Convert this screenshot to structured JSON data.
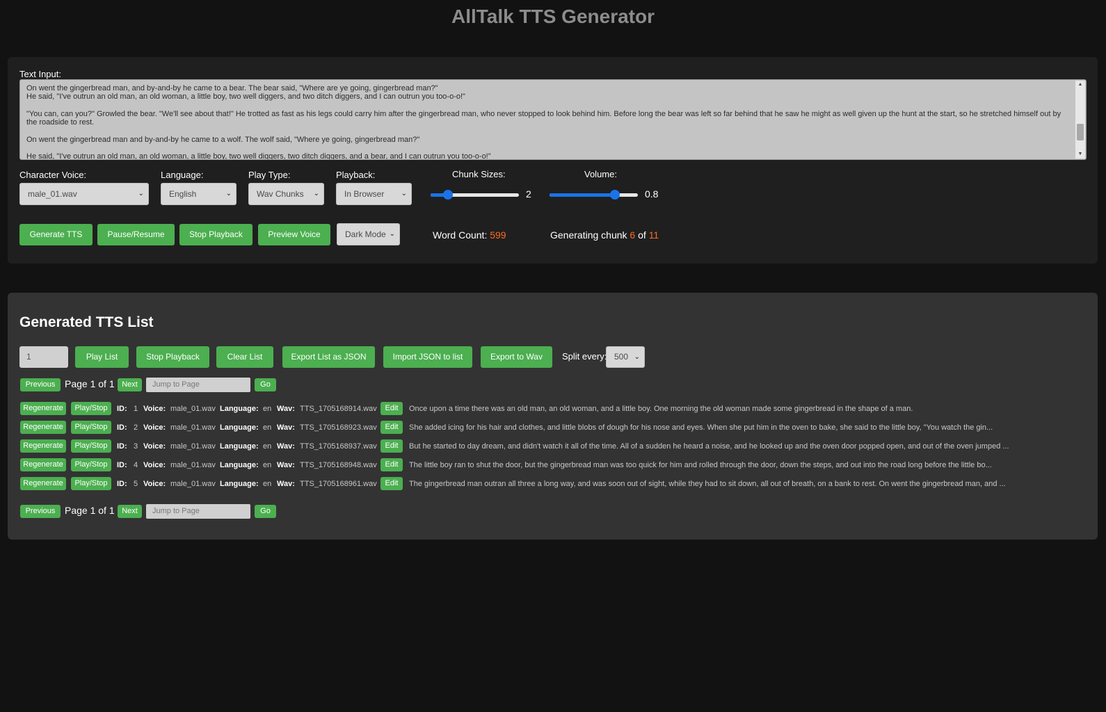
{
  "app": {
    "title": "AllTalk TTS Generator"
  },
  "input_panel": {
    "text_label": "Text Input:",
    "text_paragraphs": [
      "On went the gingerbread man, and by-and-by he came to a bear. The bear said, \"Where are ye going, gingerbread man?\"\nHe said, \"I've outrun an old man, an old woman, a little boy, two well diggers, and two ditch diggers, and I can outrun you too-o-o!\"",
      "\"You can, can you?\" Growled the bear. \"We'll see about that!\" He trotted as fast as his legs could carry him after the gingerbread man, who never stopped to look behind him. Before long the bear was left so far behind that he saw he might as well given up the hunt at the start, so he stretched himself out by the roadside to rest.",
      "On went the gingerbread man and by-and-by he came to a wolf. The wolf said, \"Where ye going, gingerbread man?\"",
      "He said, \"I've outrun an old man, an old woman, a little boy, two well diggers, two ditch diggers, and a bear, and I can outrun you too-o-o!\""
    ],
    "character_voice": {
      "label": "Character Voice:",
      "value": "male_01.wav"
    },
    "language": {
      "label": "Language:",
      "value": "English"
    },
    "play_type": {
      "label": "Play Type:",
      "value": "Wav Chunks"
    },
    "playback": {
      "label": "Playback:",
      "value": "In Browser"
    },
    "chunk_sizes": {
      "label": "Chunk Sizes:",
      "value": "2",
      "fraction": 0.2
    },
    "volume": {
      "label": "Volume:",
      "value": "0.8",
      "fraction": 0.74
    },
    "buttons": {
      "generate": "Generate TTS",
      "pause_resume": "Pause/Resume",
      "stop": "Stop Playback",
      "preview": "Preview Voice"
    },
    "theme_select": {
      "value": "Dark Mode"
    },
    "word_count": {
      "label": "Word Count:",
      "value": "599"
    },
    "progress": {
      "prefix": "Generating chunk",
      "current": "6",
      "of": "of",
      "total": "11"
    }
  },
  "list_panel": {
    "title": "Generated TTS List",
    "start_index": "1",
    "buttons": {
      "play_list": "Play List",
      "stop": "Stop Playback",
      "clear": "Clear List",
      "export_json": "Export List as JSON",
      "import_json": "Import JSON to list",
      "export_wav": "Export to Wav"
    },
    "split_label": "Split every:",
    "split_value": "500",
    "pager": {
      "previous": "Previous",
      "info": "Page 1 of 1",
      "next": "Next",
      "jump_placeholder": "Jump to Page",
      "go": "Go"
    },
    "row_labels": {
      "regenerate": "Regenerate",
      "play_stop": "Play/Stop",
      "id": "ID:",
      "voice": "Voice:",
      "language": "Language:",
      "wav": "Wav:",
      "edit": "Edit"
    },
    "rows": [
      {
        "id": "1",
        "voice": "male_01.wav",
        "language": "en",
        "wav": "TTS_1705168914.wav",
        "text": "Once upon a time there was an old man, an old woman, and a little boy. One morning the old woman made some gingerbread in the shape of a man."
      },
      {
        "id": "2",
        "voice": "male_01.wav",
        "language": "en",
        "wav": "TTS_1705168923.wav",
        "text": "She added icing for his hair and clothes, and little blobs of dough for his nose and eyes. When she put him in the oven to bake, she said to the little boy, \"You watch the gin..."
      },
      {
        "id": "3",
        "voice": "male_01.wav",
        "language": "en",
        "wav": "TTS_1705168937.wav",
        "text": "But he started to day dream, and didn't watch it all of the time. All of a sudden he heard a noise, and he looked up and the oven door popped open, and out of the oven jumped ..."
      },
      {
        "id": "4",
        "voice": "male_01.wav",
        "language": "en",
        "wav": "TTS_1705168948.wav",
        "text": "The little boy ran to shut the door, but the gingerbread man was too quick for him and rolled through the door, down the steps, and out into the road long before the little bo..."
      },
      {
        "id": "5",
        "voice": "male_01.wav",
        "language": "en",
        "wav": "TTS_1705168961.wav",
        "text": "The gingerbread man outran all three a long way, and was soon out of sight, while they had to sit down, all out of breath, on a bank to rest. On went the gingerbread man, and ..."
      }
    ]
  }
}
